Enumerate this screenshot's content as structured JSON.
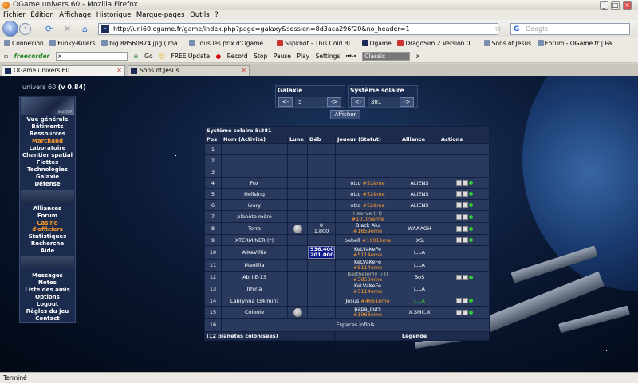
{
  "window": {
    "title": "OGame univers 60 - Mozilla Firefox"
  },
  "menu": [
    "Fichier",
    "Édition",
    "Affichage",
    "Historique",
    "Marque-pages",
    "Outils",
    "?"
  ],
  "address": {
    "url": "http://uni60.ogame.fr/game/index.php?page=galaxy&session=8d3aca296f20&no_header=1"
  },
  "search": {
    "placeholder": "Google"
  },
  "bookmarks": [
    "Connexion",
    "Funky-Killers",
    "big.88560874.jpg (Ima...",
    "Tous les prix d'Ogame ...",
    "Slipknot - This Cold Bl...",
    "Ogame",
    "DragoSim 2 Version 0....",
    "Sons of Jesus",
    "Forum - OGame.fr | Pa..."
  ],
  "toolbar2": {
    "freecorder": "freecorder",
    "x": "x",
    "go": "Go",
    "free_update": "FREE Update",
    "record": "Record",
    "stop": "Stop",
    "pause": "Pause",
    "play": "Play",
    "settings": "Settings",
    "classic": "Classic",
    "close": "x"
  },
  "tabs": [
    {
      "label": "OGame univers 60"
    },
    {
      "label": "Sons of Jesus"
    }
  ],
  "page": {
    "universe": "univers 60",
    "version": "(v 0.84)",
    "menu1": [
      "Vue générale",
      "Bâtiments",
      "Ressources",
      "Marchand",
      "Laboratoire",
      "Chantier spatial",
      "Flottes",
      "Technologies",
      "Galaxie",
      "Défense"
    ],
    "menu2": [
      "Alliances",
      "Forum",
      "Casino",
      "d'officiers",
      "Statistiques",
      "Recherche",
      "Aide"
    ],
    "menu3": [
      "Messages",
      "Notes",
      "Liste des amis",
      "Options",
      "Logout",
      "Règles du jeu",
      "Contact"
    ],
    "galaxy": {
      "label": "Galaxie",
      "value": "5"
    },
    "system": {
      "label": "Système solaire",
      "value": "381"
    },
    "nav_prev": "<-",
    "nav_next": "->",
    "show_button": "Afficher",
    "table_title": "Système solaire 5:381",
    "headers": [
      "Pos",
      "Nom (Activité)",
      "Lune",
      "Déb",
      "Joueur (Statut)",
      "Alliance",
      "Actions"
    ],
    "rows": [
      {
        "pos": "1",
        "name": "",
        "moon": false,
        "deb": "",
        "player": "",
        "rank": "",
        "alliance": "",
        "actions": false
      },
      {
        "pos": "2",
        "name": "",
        "moon": false,
        "deb": "",
        "player": "",
        "rank": "",
        "alliance": "",
        "actions": false
      },
      {
        "pos": "3",
        "name": "",
        "moon": false,
        "deb": "",
        "player": "",
        "rank": "",
        "alliance": "",
        "actions": false
      },
      {
        "pos": "4",
        "name": "Fox",
        "moon": false,
        "deb": "",
        "player": "otto",
        "rank": "#52ème",
        "alliance": "ALIENS",
        "actions": true
      },
      {
        "pos": "5",
        "name": "Hellsing",
        "moon": false,
        "deb": "",
        "player": "otto",
        "rank": "#52ème",
        "alliance": "ALIENS",
        "actions": true
      },
      {
        "pos": "6",
        "name": "Ivory",
        "moon": false,
        "deb": "",
        "player": "otto",
        "rank": "#52ème",
        "alliance": "ALIENS",
        "actions": true
      },
      {
        "pos": "7",
        "name": "planète mère",
        "moon": false,
        "deb": "",
        "player": "Heerve (i I)",
        "rank": "#10105ème",
        "alliance": "",
        "actions": true,
        "inactive": true
      },
      {
        "pos": "8",
        "name": "Terra",
        "moon": true,
        "deb": "0\n1.800",
        "player": "Black Alu",
        "rank": "#1659ème",
        "alliance": "WAAAGH",
        "actions": true
      },
      {
        "pos": "9",
        "name": "XTERMINER (*)",
        "moon": false,
        "deb": "",
        "player": "bebell",
        "rank": "#1901ème",
        "alliance": ".XS.",
        "actions": true
      },
      {
        "pos": "10",
        "name": "AlKaViRia",
        "moon": false,
        "deb": "536.400\n201.000",
        "debblue": true,
        "player": "KeLVaKeFe",
        "rank": "#5114ème",
        "alliance": "L.LA",
        "actions": false
      },
      {
        "pos": "11",
        "name": "Manillia",
        "moon": false,
        "deb": "",
        "player": "KeLVaKeFe",
        "rank": "#5114ème",
        "alliance": "L.LA",
        "actions": false
      },
      {
        "pos": "12",
        "name": "Abri E-13",
        "moon": false,
        "deb": "",
        "player": "Barthelemy (i I)",
        "rank": "#3853ème",
        "alliance": "BoS",
        "actions": true,
        "inactive": true
      },
      {
        "pos": "13",
        "name": "Ithiria",
        "moon": false,
        "deb": "",
        "player": "KeLVaKeFe",
        "rank": "#5114ème",
        "alliance": "L.LA",
        "actions": false
      },
      {
        "pos": "14",
        "name": "Labrynna (34 min)",
        "moon": false,
        "deb": "",
        "player": "Jesus",
        "rank": "#4661ème",
        "alliance": "L.LA",
        "alliancegreen": true,
        "actions": true
      },
      {
        "pos": "15",
        "name": "Colonie",
        "moon": true,
        "deb": "",
        "player": "papa_ours",
        "rank": "#1968ème",
        "alliance": "X.SMC.X",
        "actions": true
      }
    ],
    "row16_pos": "16",
    "row16_text": "Espaces infinis",
    "footer_left": "(12 planètes colonisées)",
    "footer_right": "Légende"
  },
  "status": "Terminé"
}
